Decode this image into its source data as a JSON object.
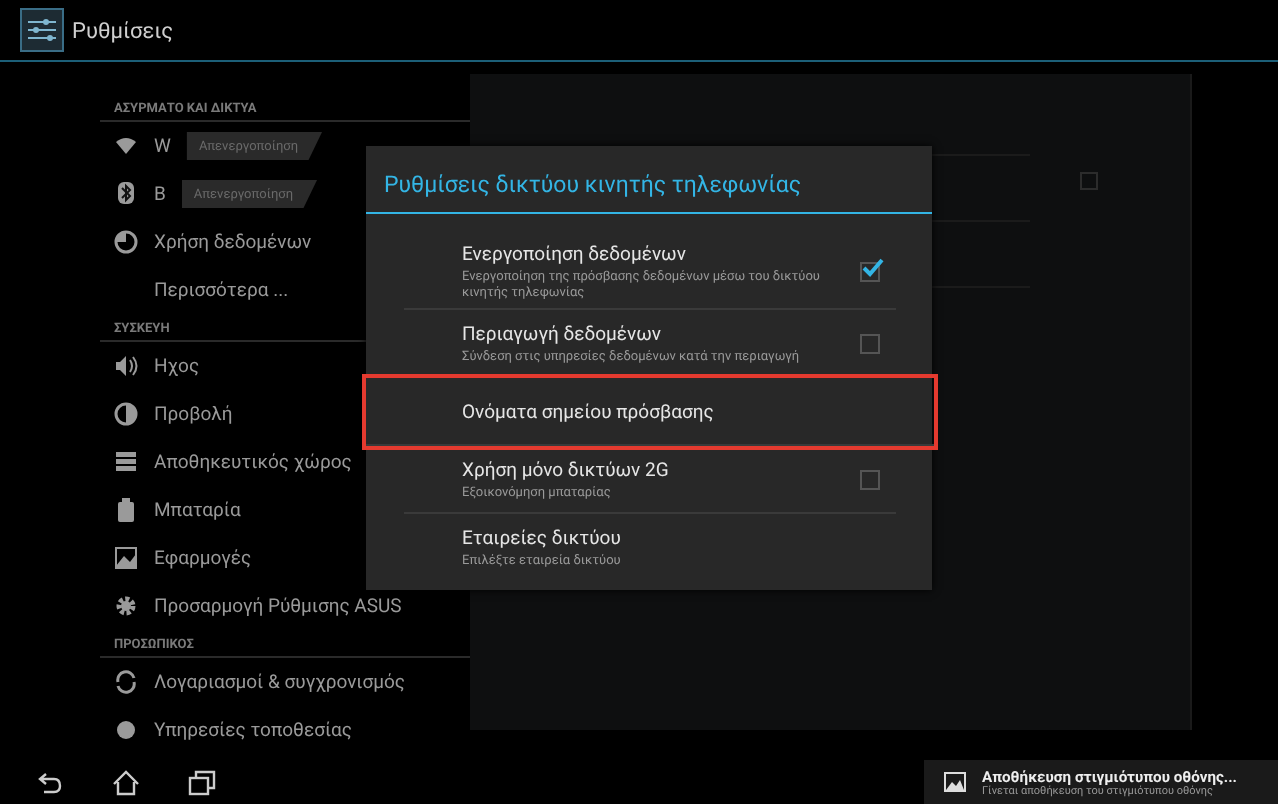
{
  "app_bar": {
    "title": "Ρυθμίσεις"
  },
  "sidebar": {
    "items": [
      {
        "kind": "header",
        "label": "ΑΣΥΡΜΑΤΟ ΚΑΙ ΔΙΚΤΥΑ"
      },
      {
        "kind": "toggle",
        "label": "W",
        "switch_label": "Απενεργοποίηση",
        "on": false
      },
      {
        "kind": "toggle",
        "label": "B",
        "switch_label": "Απενεργοποίηση",
        "on": false
      },
      {
        "kind": "item",
        "label": "Χρήση δεδομένων"
      },
      {
        "kind": "item",
        "label": "Περισσότερα ..."
      },
      {
        "kind": "header",
        "label": "ΣΥΣΚΕΥΗ"
      },
      {
        "kind": "item",
        "label": "Ηχος"
      },
      {
        "kind": "item",
        "label": "Προβολή"
      },
      {
        "kind": "item",
        "label": "Αποθηκευτικός χώρος"
      },
      {
        "kind": "item",
        "label": "Μπαταρία"
      },
      {
        "kind": "item",
        "label": "Εφαρμογές"
      },
      {
        "kind": "item",
        "label": "Προσαρμογή Ρύθμισης ASUS"
      },
      {
        "kind": "header",
        "label": "ΠΡΟΣΩΠΙΚΟΣ"
      },
      {
        "kind": "item",
        "label": "Λογαριασμοί & συγχρονισμός"
      },
      {
        "kind": "item",
        "label": "Υπηρεσίες τοποθεσίας"
      }
    ]
  },
  "detail_pane": {
    "checked": false
  },
  "dialog": {
    "title": "Ρυθμίσεις δικτύου κινητής τηλεφωνίας",
    "items": [
      {
        "kind": "checkbox",
        "title": "Ενεργοποίηση δεδομένων",
        "summary": "Ενεργοποίηση της πρόσβασης δεδομένων μέσω του δικτύου κινητής τηλεφωνίας",
        "checked": true,
        "highlighted": false
      },
      {
        "kind": "checkbox",
        "title": "Περιαγωγή δεδομένων",
        "summary": "Σύνδεση στις υπηρεσίες δεδομένων κατά την περιαγωγή",
        "checked": false,
        "highlighted": false
      },
      {
        "kind": "plain",
        "title": "Ονόματα σημείου πρόσβασης",
        "highlighted": true
      },
      {
        "kind": "checkbox",
        "title": "Χρήση μόνο δικτύων 2G",
        "summary": "Εξοικονόμηση μπαταρίας",
        "checked": false,
        "highlighted": false
      },
      {
        "kind": "plain",
        "title": "Εταιρείες δικτύου",
        "summary": "Επιλέξτε εταιρεία δικτύου",
        "highlighted": false
      }
    ]
  },
  "notification": {
    "title": "Αποθήκευση στιγμιότυπου οθόνης...",
    "text": "Γίνεται αποθήκευση του στιγμιότυπου οθόνης"
  }
}
